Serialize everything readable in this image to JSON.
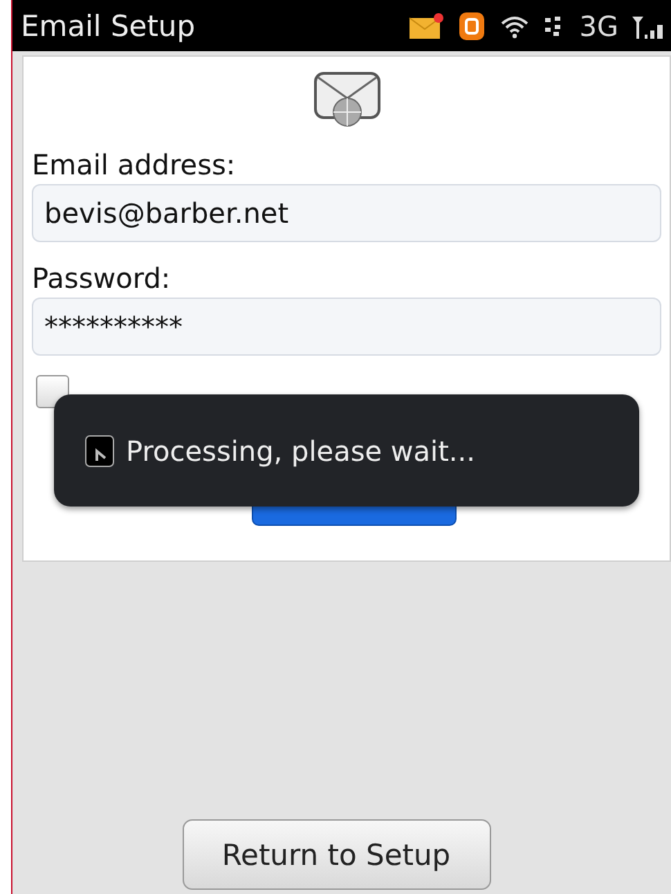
{
  "status_bar": {
    "title": "Email Setup",
    "network": "3G"
  },
  "form": {
    "fields": [
      {
        "label": "Email address:",
        "value": "bevis@barber.net"
      },
      {
        "label": "Password:",
        "value": "**********"
      }
    ],
    "show_password": {
      "checked": false
    }
  },
  "dialog": {
    "message": "Processing, please wait..."
  },
  "buttons": [
    {
      "label": "Return to Setup"
    }
  ]
}
